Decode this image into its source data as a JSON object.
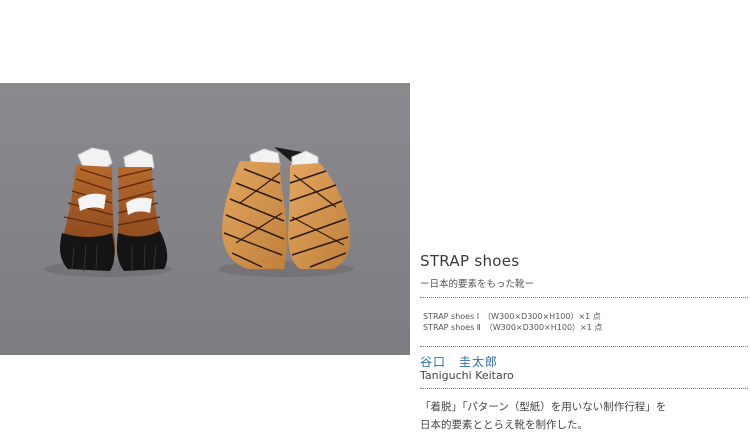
{
  "work": {
    "title": "STRAP shoes",
    "subtitle": "ー日本的要素をもった靴ー",
    "specs": [
      "STRAP shoes Ⅰ　（W300×D300×H100）×1 点",
      "STRAP shoes Ⅱ　（W300×D300×H100）×1 点"
    ],
    "author_ja": "谷口　圭太郎",
    "author_en": "Taniguchi Keitaro",
    "description": [
      "「着脱」「パターン（型紙）を用いない制作行程」を",
      "日本的要素ととらえ靴を制作した。"
    ]
  },
  "colors": {
    "accent_name": "#2f6db5",
    "photo_background": "#858488",
    "strap_brown": "#a05a26",
    "strap_tan": "#d2944e",
    "sole_black": "#141414",
    "last_white": "#f2f2f2"
  }
}
